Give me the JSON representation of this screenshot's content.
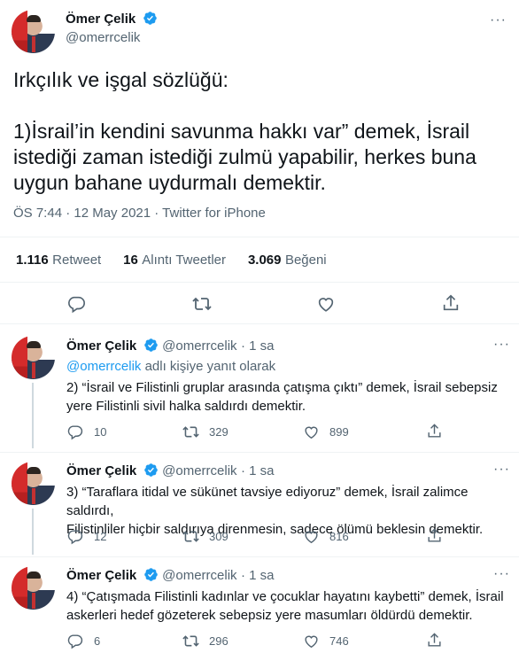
{
  "colors": {
    "accent": "#1d9bf0",
    "muted": "#536471",
    "text": "#0f1419",
    "divider": "#eff3f4"
  },
  "main_tweet": {
    "author_name": "Ömer Çelik",
    "author_handle": "@omerrcelik",
    "verified_icon": "verified-badge-icon",
    "text_lines": [
      "Irkçılık ve işgal sözlüğü:",
      "1)İsrail’in kendini savunma hakkı var” demek, İsrail",
      "istediği zaman istediği zulmü yapabilir, herkes buna",
      "uygun bahane uydurmalı demektir."
    ],
    "timestamp": "ÖS 7:44 · 12 May 2021 · Twitter for iPhone",
    "stats": {
      "retweets_num": "1.116",
      "retweets_label": "Retweet",
      "quotes_num": "16",
      "quotes_label": "Alıntı Tweetler",
      "likes_num": "3.069",
      "likes_label": "Beğeni"
    },
    "actions": [
      "reply-icon",
      "retweet-icon",
      "like-icon",
      "share-icon"
    ]
  },
  "replies": [
    {
      "author_name": "Ömer Çelik",
      "author_handle": "@omerrcelik",
      "time": "· 1 sa",
      "reply_to_handle": "@omerrcelik",
      "reply_to_suffix": " adlı kişiye yanıt olarak",
      "text_lines": [
        "2) “İsrail ve Filistinli gruplar arasında çatışma çıktı” demek, İsrail sebepsiz",
        "yere Filistinli sivil halka saldırdı demektir."
      ],
      "reply_count": "10",
      "retweet_count": "329",
      "like_count": "899"
    },
    {
      "author_name": "Ömer Çelik",
      "author_handle": "@omerrcelik",
      "time": "· 1 sa",
      "text_lines": [
        "3) “Taraflara itidal ve sükünet tavsiye ediyoruz” demek, İsrail zalimce saldırdı,",
        "Filistinliler hiçbir saldırıya direnmesin, sadece ölümü beklesin demektir."
      ],
      "reply_count": "12",
      "retweet_count": "309",
      "like_count": "816"
    },
    {
      "author_name": "Ömer Çelik",
      "author_handle": "@omerrcelik",
      "time": "· 1 sa",
      "text_lines": [
        "4) “Çatışmada Filistinli kadınlar ve çocuklar hayatını kaybetti” demek, İsrail",
        "askerleri hedef gözeterek sebepsiz yere masumları öldürdü demektir."
      ],
      "reply_count": "6",
      "retweet_count": "296",
      "like_count": "746"
    }
  ],
  "more_icon": "more-horizontal-icon"
}
